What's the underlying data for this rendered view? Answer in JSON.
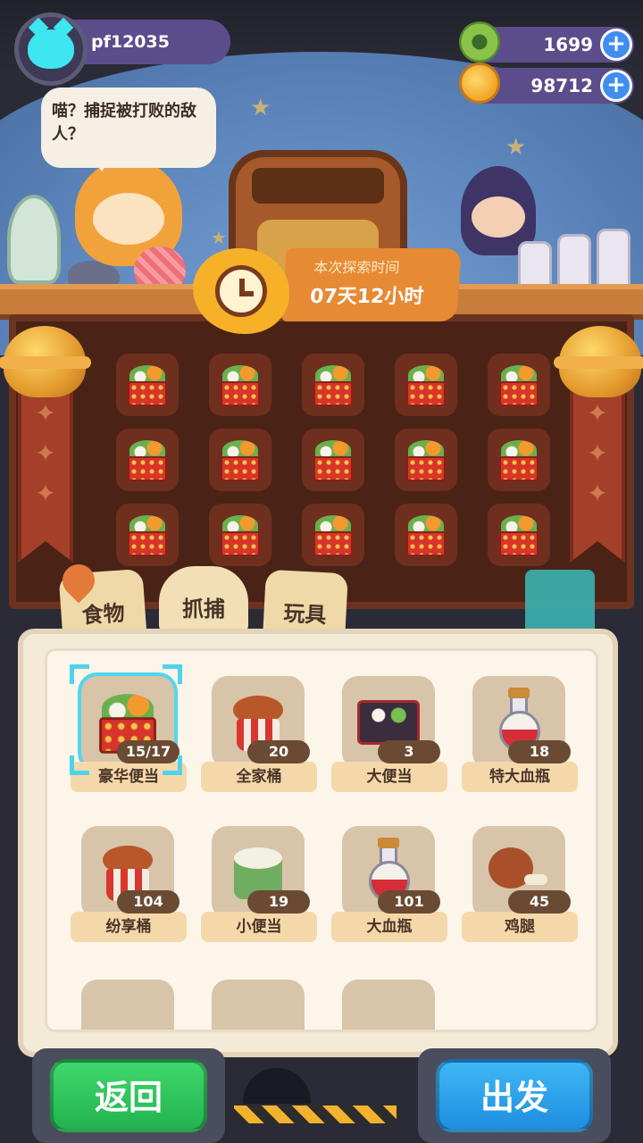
{
  "player": {
    "name": "pf12035"
  },
  "currency": {
    "donut": {
      "value": "1699",
      "icon": "donut-icon",
      "color": "#8bc34a"
    },
    "coin": {
      "value": "98712",
      "icon": "coin-planet-icon",
      "color": "#f7b52c"
    },
    "plus_label": "+"
  },
  "speech": {
    "text": "喵？捕捉被打败的敌人？"
  },
  "explore": {
    "label": "本次探索时间",
    "value": "07天12小时"
  },
  "tabs": [
    {
      "label": "食物",
      "active": false
    },
    {
      "label": "抓捕",
      "active": true
    },
    {
      "label": "玩具",
      "active": false
    }
  ],
  "items": [
    {
      "name": "豪华便当",
      "count": "15/17",
      "icon": "bento-icon",
      "selected": true
    },
    {
      "name": "全家桶",
      "count": "20",
      "icon": "chicken-bucket-icon"
    },
    {
      "name": "大便当",
      "count": "3",
      "icon": "lunchbox-icon"
    },
    {
      "name": "特大血瓶",
      "count": "18",
      "icon": "potion-icon"
    },
    {
      "name": "纷享桶",
      "count": "104",
      "icon": "chicken-bucket-icon"
    },
    {
      "name": "小便当",
      "count": "19",
      "icon": "rice-drum-icon"
    },
    {
      "name": "大血瓶",
      "count": "101",
      "icon": "potion-icon"
    },
    {
      "name": "鸡腿",
      "count": "45",
      "icon": "drumstick-icon"
    }
  ],
  "buttons": {
    "back": "返回",
    "go": "出发"
  },
  "colors": {
    "accent_green": "#2ec65b",
    "accent_blue": "#2a9fea",
    "selection": "#4fd3ec"
  }
}
